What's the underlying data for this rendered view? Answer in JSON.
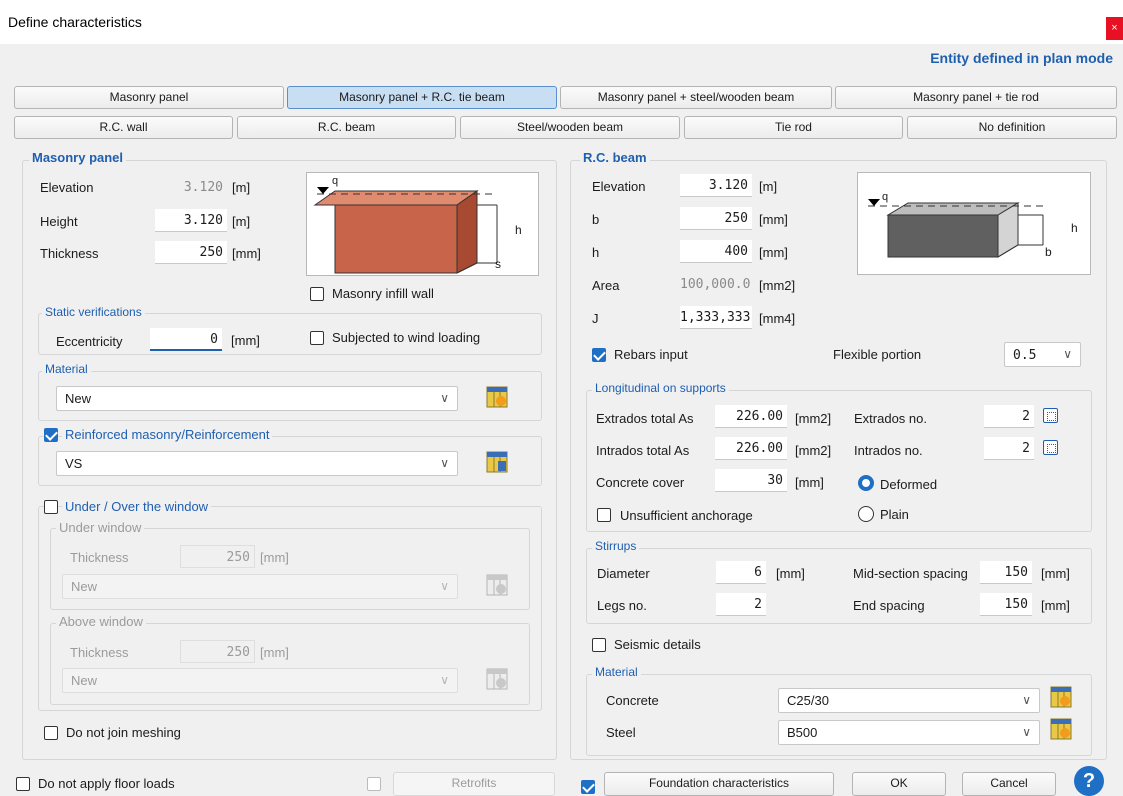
{
  "window": {
    "title": "Define characteristics",
    "close": "×"
  },
  "entity_mode": "Entity defined in plan mode",
  "tabs_row1": [
    "Masonry panel",
    "Masonry panel + R.C. tie beam",
    "Masonry panel + steel/wooden beam",
    "Masonry panel + tie rod"
  ],
  "tabs_row2": [
    "R.C. wall",
    "R.C. beam",
    "Steel/wooden beam",
    "Tie rod",
    "No definition"
  ],
  "masonry": {
    "title": "Masonry panel",
    "elevation_label": "Elevation",
    "elevation": "3.120",
    "elevation_unit": "[m]",
    "height_label": "Height",
    "height": "3.120",
    "height_unit": "[m]",
    "thickness_label": "Thickness",
    "thickness": "250",
    "thickness_unit": "[mm]",
    "diagram_q": "q",
    "diagram_h": "h",
    "diagram_s": "s",
    "infill_label": "Masonry infill wall",
    "static_title": "Static verifications",
    "eccentricity_label": "Eccentricity",
    "eccentricity": "0",
    "eccentricity_unit": "[mm]",
    "wind_label": "Subjected to wind loading",
    "material_title": "Material",
    "material_value": "New",
    "reinforced_label": "Reinforced masonry/Reinforcement",
    "reinforced_value": "VS",
    "window_label": "Under / Over the window",
    "under_title": "Under window",
    "under_thickness_label": "Thickness",
    "under_thickness": "250",
    "under_unit": "[mm]",
    "under_material": "New",
    "above_title": "Above window",
    "above_thickness_label": "Thickness",
    "above_thickness": "250",
    "above_unit": "[mm]",
    "above_material": "New",
    "no_join_label": "Do not join meshing"
  },
  "beam": {
    "title": "R.C. beam",
    "elevation_label": "Elevation",
    "elevation": "3.120",
    "elevation_unit": "[m]",
    "b_label": "b",
    "b": "250",
    "b_unit": "[mm]",
    "h_label": "h",
    "h": "400",
    "h_unit": "[mm]",
    "area_label": "Area",
    "area": "100,000.0",
    "area_unit": "[mm2]",
    "j_label": "J",
    "j": "1,333,333",
    "j_unit": "[mm4]",
    "diagram_q": "q",
    "diagram_h": "h",
    "diagram_b": "b",
    "rebars_label": "Rebars input",
    "flexible_label": "Flexible portion",
    "flexible_value": "0.5",
    "long_title": "Longitudinal on supports",
    "extrados_as_label": "Extrados total As",
    "extrados_as": "226.00",
    "extrados_as_unit": "[mm2]",
    "extrados_no_label": "Extrados no.",
    "extrados_no": "2",
    "intrados_as_label": "Intrados total As",
    "intrados_as": "226.00",
    "intrados_as_unit": "[mm2]",
    "intrados_no_label": "Intrados no.",
    "intrados_no": "2",
    "cover_label": "Concrete cover",
    "cover": "30",
    "cover_unit": "[mm]",
    "deformed_label": "Deformed",
    "plain_label": "Plain",
    "anchorage_label": "Unsufficient anchorage",
    "stirrups_title": "Stirrups",
    "diameter_label": "Diameter",
    "diameter": "6",
    "diameter_unit": "[mm]",
    "mid_spacing_label": "Mid-section spacing",
    "mid_spacing": "150",
    "mid_spacing_unit": "[mm]",
    "legs_label": "Legs no.",
    "legs": "2",
    "end_spacing_label": "End spacing",
    "end_spacing": "150",
    "end_spacing_unit": "[mm]",
    "seismic_label": "Seismic details",
    "material_title": "Material",
    "concrete_label": "Concrete",
    "concrete_value": "C25/30",
    "steel_label": "Steel",
    "steel_value": "B500"
  },
  "footer": {
    "no_floor_loads_label": "Do not apply floor loads",
    "retrofits_label": "Retrofits",
    "foundation_label": "Foundation characteristics",
    "ok_label": "OK",
    "cancel_label": "Cancel",
    "help": "?"
  },
  "colors": {
    "accent": "#1f5fb0",
    "masonry": "#c8644a",
    "concrete": "#606060",
    "checkbox": "#1f6fc4"
  },
  "icons": [
    "close-icon",
    "library-icon",
    "grid-icon",
    "chevron-down-icon",
    "help-icon",
    "checkbox-icon",
    "radio-icon"
  ]
}
